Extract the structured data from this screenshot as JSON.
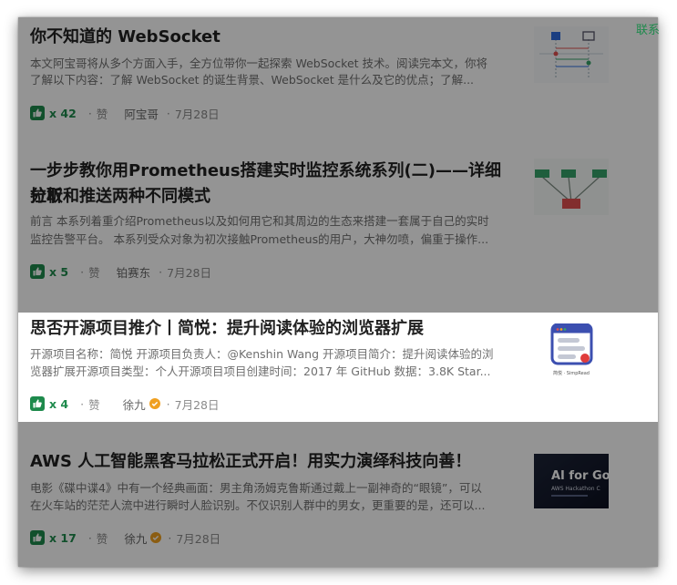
{
  "contact_label": "联系",
  "like_label": "赞",
  "thumbnail_texts": {
    "simpread": "简悦 · SimpRead",
    "aws_line1": "AI for Go",
    "aws_line2": "AWS Hackathon C"
  },
  "colors": {
    "accent": "#1e8a4c",
    "verified": "#f0a020",
    "text": "#222222",
    "muted": "#8a8a8a"
  },
  "articles": [
    {
      "title": "你不知道的 WebSocket",
      "desc_line1": "本文阿宝哥将从多个方面入手，全方位带你一起探索 WebSocket 技术。阅读完本文，你将",
      "desc_line2": "了解以下内容：了解 WebSocket 的诞生背景、WebSocket 是什么及它的优点；了解...",
      "likes": "x 42",
      "author": "阿宝哥",
      "date": "7月28日",
      "verified": false,
      "thumbnail_icon": "flow-diagram-thumbnail"
    },
    {
      "title_line1": "一步步教你用Prometheus搭建实时监控系统系列(二)——详细分析",
      "title_line2": "拉取和推送两种不同模式",
      "desc_line1": "前言 本系列着重介绍Prometheus以及如何用它和其周边的生态来搭建一套属于自己的实时",
      "desc_line2": "监控告警平台。 本系列受众对象为初次接触Prometheus的用户，大神勿喷，偏重于操作...",
      "likes": "x 5",
      "author": "铂赛东",
      "date": "7月28日",
      "verified": false,
      "thumbnail_icon": "tree-diagram-thumbnail"
    },
    {
      "title": "思否开源项目推介丨简悦：提升阅读体验的浏览器扩展",
      "desc_line1": "开源项目名称：简悦 开源项目负责人：@Kenshin Wang 开源项目简介：提升阅读体验的浏",
      "desc_line2": "览器扩展开源项目类型：个人开源项目项目创建时间：2017 年 GitHub 数据：3.8K Star...",
      "likes": "x 4",
      "author": "徐九",
      "date": "7月28日",
      "verified": true,
      "thumbnail_icon": "simpread-logo-thumbnail"
    },
    {
      "title": "AWS 人工智能黑客马拉松正式开启！用实力演绎科技向善！",
      "desc_line1": "电影《碟中谍4》中有一个经典画面：男主角汤姆克鲁斯通过戴上一副神奇的“眼镜”，可以",
      "desc_line2": "在火车站的茫茫人流中进行瞬时人脸识别。不仅识别人群中的男女，更重要的是，还可以...",
      "likes": "x 17",
      "author": "徐九",
      "date": "7月28日",
      "verified": true,
      "thumbnail_icon": "aws-hackathon-banner-thumbnail"
    }
  ]
}
